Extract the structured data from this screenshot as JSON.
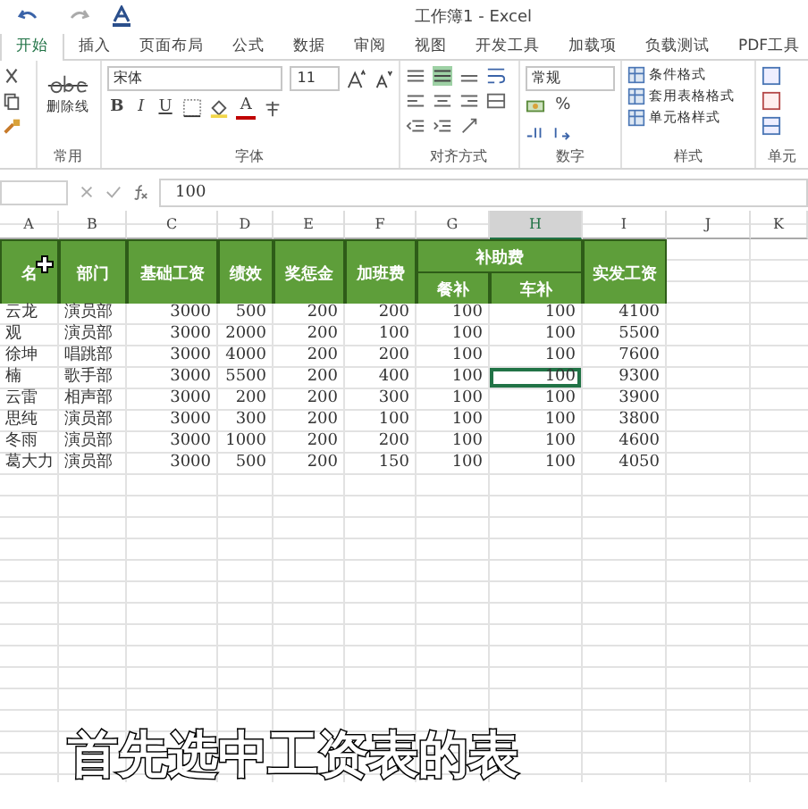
{
  "window": {
    "title": "工作簿1 - Excel"
  },
  "tabs": [
    {
      "label": "开始",
      "selected": true
    },
    {
      "label": "插入",
      "selected": false
    },
    {
      "label": "页面布局",
      "selected": false
    },
    {
      "label": "公式",
      "selected": false
    },
    {
      "label": "数据",
      "selected": false
    },
    {
      "label": "审阅",
      "selected": false
    },
    {
      "label": "视图",
      "selected": false
    },
    {
      "label": "开发工具",
      "selected": false
    },
    {
      "label": "加载项",
      "selected": false
    },
    {
      "label": "负载测试",
      "selected": false
    },
    {
      "label": "PDF工具",
      "selected": false
    }
  ],
  "ribbon": {
    "common": {
      "button": "删除线",
      "label": "常用"
    },
    "font": {
      "family": "宋体",
      "size": "11",
      "bold": "B",
      "italic": "I",
      "underline": "U",
      "color_letter": "A",
      "label": "字体"
    },
    "alignment": {
      "label": "对齐方式"
    },
    "number": {
      "format": "常规",
      "percent": "%",
      "label": "数字"
    },
    "styles": {
      "items": [
        "条件格式",
        "套用表格格式",
        "单元格样式"
      ],
      "label": "样式"
    },
    "cells": {
      "label": "单元"
    }
  },
  "formula_bar": {
    "value": "100"
  },
  "sheet": {
    "columns": [
      {
        "label": "A",
        "selected": false
      },
      {
        "label": "B",
        "selected": false
      },
      {
        "label": "C",
        "selected": false
      },
      {
        "label": "D",
        "selected": false
      },
      {
        "label": "E",
        "selected": false
      },
      {
        "label": "F",
        "selected": false
      },
      {
        "label": "G",
        "selected": false
      },
      {
        "label": "H",
        "selected": true
      },
      {
        "label": "I",
        "selected": false
      },
      {
        "label": "J",
        "selected": false
      },
      {
        "label": "K",
        "selected": false
      }
    ],
    "header": {
      "names": [
        "名",
        "部门",
        "基础工资",
        "绩效",
        "奖惩金",
        "加班费"
      ],
      "group": "补助费",
      "subs": [
        "餐补",
        "车补"
      ],
      "total": "实发工资"
    },
    "rows": [
      {
        "cells": [
          {
            "text": "云龙",
            "selected": false
          },
          {
            "text": "演员部",
            "selected": false
          },
          {
            "text": "3000",
            "selected": false
          },
          {
            "text": "500",
            "selected": false
          },
          {
            "text": "200",
            "selected": false
          },
          {
            "text": "200",
            "selected": false
          },
          {
            "text": "100",
            "selected": false
          },
          {
            "text": "100",
            "selected": false
          },
          {
            "text": "4100",
            "selected": false
          }
        ]
      },
      {
        "cells": [
          {
            "text": "观",
            "selected": false
          },
          {
            "text": "演员部",
            "selected": false
          },
          {
            "text": "3000",
            "selected": false
          },
          {
            "text": "2000",
            "selected": false
          },
          {
            "text": "200",
            "selected": false
          },
          {
            "text": "100",
            "selected": false
          },
          {
            "text": "100",
            "selected": false
          },
          {
            "text": "100",
            "selected": false
          },
          {
            "text": "5500",
            "selected": false
          }
        ]
      },
      {
        "cells": [
          {
            "text": "徐坤",
            "selected": false
          },
          {
            "text": "唱跳部",
            "selected": false
          },
          {
            "text": "3000",
            "selected": false
          },
          {
            "text": "4000",
            "selected": false
          },
          {
            "text": "200",
            "selected": false
          },
          {
            "text": "200",
            "selected": false
          },
          {
            "text": "100",
            "selected": false
          },
          {
            "text": "100",
            "selected": false
          },
          {
            "text": "7600",
            "selected": false
          }
        ]
      },
      {
        "cells": [
          {
            "text": "楠",
            "selected": false
          },
          {
            "text": "歌手部",
            "selected": false
          },
          {
            "text": "3000",
            "selected": false
          },
          {
            "text": "5500",
            "selected": false
          },
          {
            "text": "200",
            "selected": false
          },
          {
            "text": "400",
            "selected": false
          },
          {
            "text": "100",
            "selected": false
          },
          {
            "text": "100",
            "selected": true
          },
          {
            "text": "9300",
            "selected": false
          }
        ]
      },
      {
        "cells": [
          {
            "text": "云雷",
            "selected": false
          },
          {
            "text": "相声部",
            "selected": false
          },
          {
            "text": "3000",
            "selected": false
          },
          {
            "text": "200",
            "selected": false
          },
          {
            "text": "200",
            "selected": false
          },
          {
            "text": "300",
            "selected": false
          },
          {
            "text": "100",
            "selected": false
          },
          {
            "text": "100",
            "selected": false
          },
          {
            "text": "3900",
            "selected": false
          }
        ]
      },
      {
        "cells": [
          {
            "text": "思纯",
            "selected": false
          },
          {
            "text": "演员部",
            "selected": false
          },
          {
            "text": "3000",
            "selected": false
          },
          {
            "text": "300",
            "selected": false
          },
          {
            "text": "200",
            "selected": false
          },
          {
            "text": "100",
            "selected": false
          },
          {
            "text": "100",
            "selected": false
          },
          {
            "text": "100",
            "selected": false
          },
          {
            "text": "3800",
            "selected": false
          }
        ]
      },
      {
        "cells": [
          {
            "text": "冬雨",
            "selected": false
          },
          {
            "text": "演员部",
            "selected": false
          },
          {
            "text": "3000",
            "selected": false
          },
          {
            "text": "1000",
            "selected": false
          },
          {
            "text": "200",
            "selected": false
          },
          {
            "text": "200",
            "selected": false
          },
          {
            "text": "100",
            "selected": false
          },
          {
            "text": "100",
            "selected": false
          },
          {
            "text": "4600",
            "selected": false
          }
        ]
      },
      {
        "cells": [
          {
            "text": "葛大力",
            "selected": false
          },
          {
            "text": "演员部",
            "selected": false
          },
          {
            "text": "3000",
            "selected": false
          },
          {
            "text": "500",
            "selected": false
          },
          {
            "text": "200",
            "selected": false
          },
          {
            "text": "150",
            "selected": false
          },
          {
            "text": "100",
            "selected": false
          },
          {
            "text": "100",
            "selected": false
          },
          {
            "text": "4050",
            "selected": false
          }
        ]
      }
    ]
  },
  "caption": "首先选中工资表的表"
}
